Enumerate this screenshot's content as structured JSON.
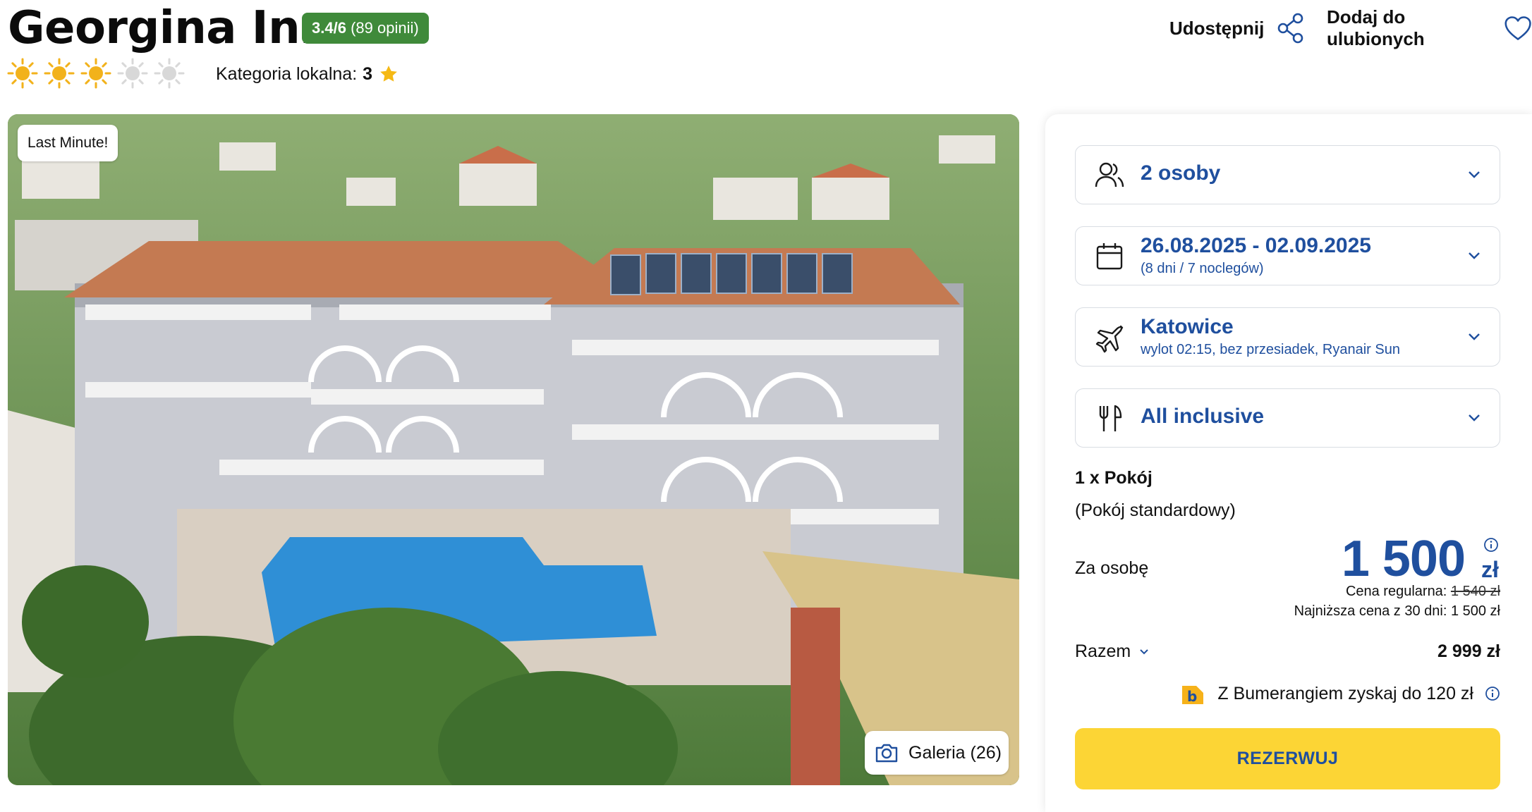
{
  "hotel": {
    "name": "Georgina Inn",
    "rating": "3.4/6",
    "reviews": "(89 opinii)",
    "sun_rating": 3,
    "sun_max": 5,
    "local_category_label": "Kategoria lokalna:",
    "local_category_value": "3"
  },
  "header_actions": {
    "share_label": "Udostępnij",
    "favorite_label": "Dodaj do ulubionych"
  },
  "photo": {
    "badge": "Last Minute!",
    "gallery_label": "Galeria (26)"
  },
  "booking": {
    "persons": "2 osoby",
    "dates": "26.08.2025 - 02.09.2025",
    "dates_sub": "(8 dni / 7 noclegów)",
    "departure_city": "Katowice",
    "flight_info": "wylot 02:15, bez przesiadek, Ryanair Sun",
    "board": "All inclusive",
    "room_count": "1 x Pokój",
    "room_type": "(Pokój standardowy)",
    "per_person_label": "Za osobę",
    "price": "1 500",
    "currency": "zł",
    "regular_price_label": "Cena regularna:",
    "regular_price_value": "1 540 zł",
    "lowest_price_text": "Najniższa cena z 30 dni: 1 500 zł",
    "total_label": "Razem",
    "total_value": "2 999 zł",
    "bumerang_text": "Z Bumerangiem zyskaj do 120 zł",
    "reserve_label": "REZERWUJ"
  },
  "colors": {
    "accent_blue": "#1f4f9e",
    "rating_green": "#3f8a3a",
    "sun_yellow": "#f2b21b",
    "sun_gray": "#d8d8d8",
    "reserve_yellow": "#fcd535"
  }
}
